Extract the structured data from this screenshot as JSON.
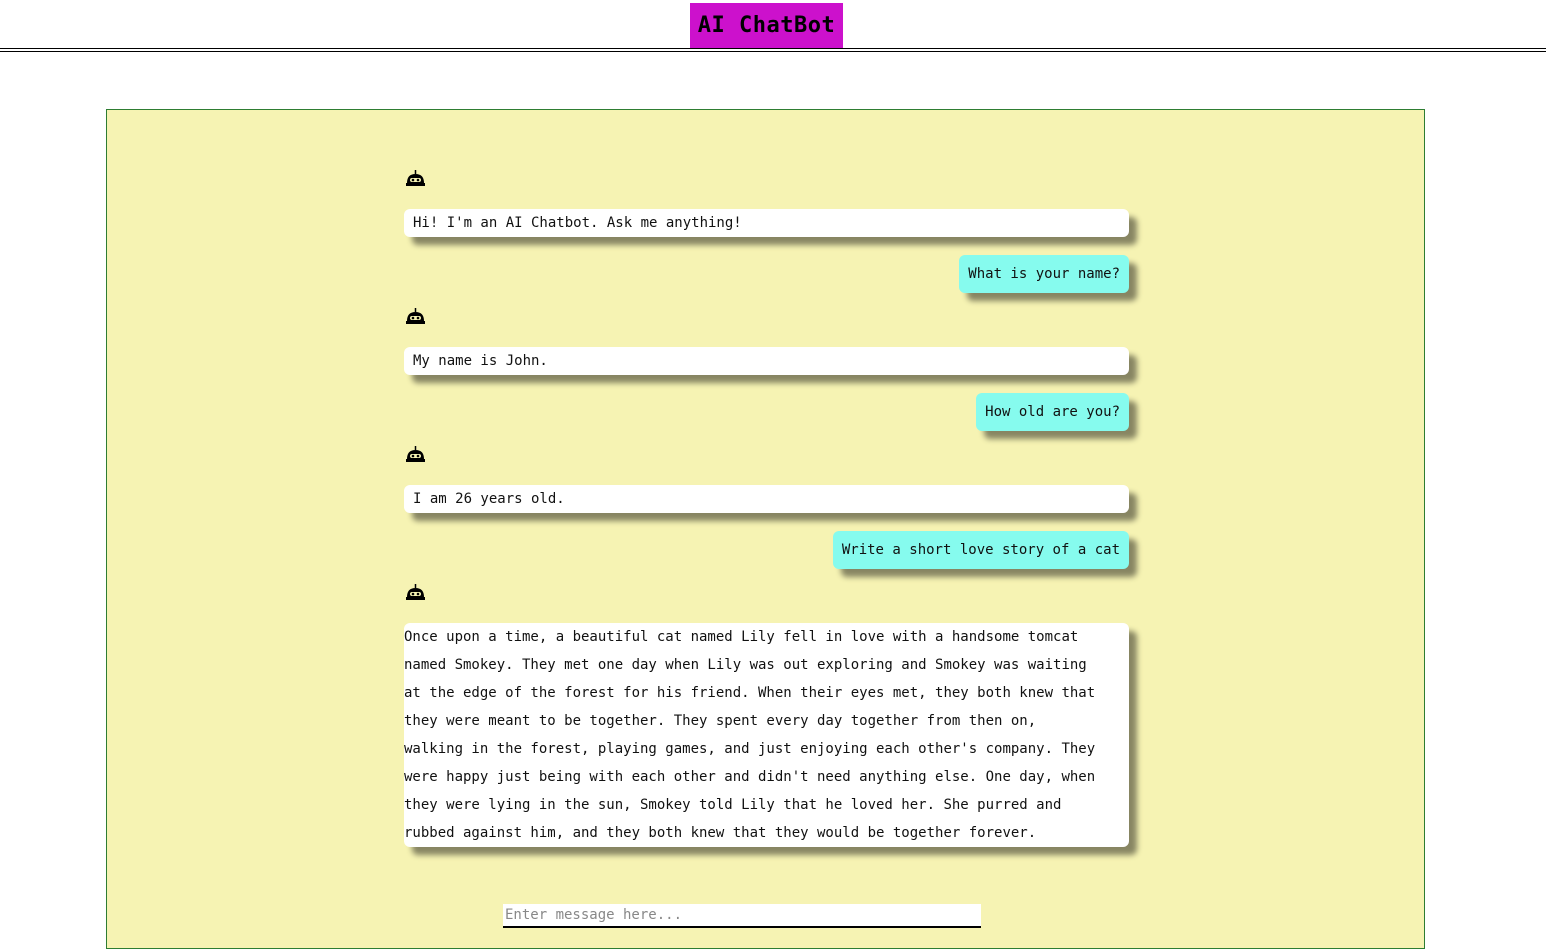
{
  "header": {
    "title": "AI ChatBot",
    "title_bg": "#cc11cc"
  },
  "chat": {
    "panel_bg": "#f6f3b3",
    "bot_bubble_bg": "#ffffff",
    "user_bubble_bg": "#86fbee",
    "bot_icon": "robot-icon",
    "messages": [
      {
        "role": "bot",
        "text": "Hi! I'm an AI Chatbot. Ask me anything!"
      },
      {
        "role": "user",
        "text": "What is your name?"
      },
      {
        "role": "bot",
        "text": "My name is John."
      },
      {
        "role": "user",
        "text": "How old are you?"
      },
      {
        "role": "bot",
        "text": "I am 26 years old."
      },
      {
        "role": "user",
        "text": "Write a short love story of a cat"
      },
      {
        "role": "bot",
        "lines": [
          " Once upon a time, a beautiful cat named Lily fell in love with a handsome tomcat",
          "named Smokey. They met one day when Lily was out exploring and Smokey was waiting",
          "at the edge of the forest for his friend. When their eyes met, they both knew that",
          "they were meant to be together. They spent every day together from then on,",
          "walking in the forest, playing games, and just enjoying each other's company. They",
          "were happy just being with each other and didn't need anything else. One day, when",
          "they were lying in the sun, Smokey told Lily that he loved her. She purred and",
          "rubbed against him, and they both knew that they would be together forever."
        ]
      }
    ]
  },
  "input": {
    "placeholder": "Enter message here..."
  }
}
